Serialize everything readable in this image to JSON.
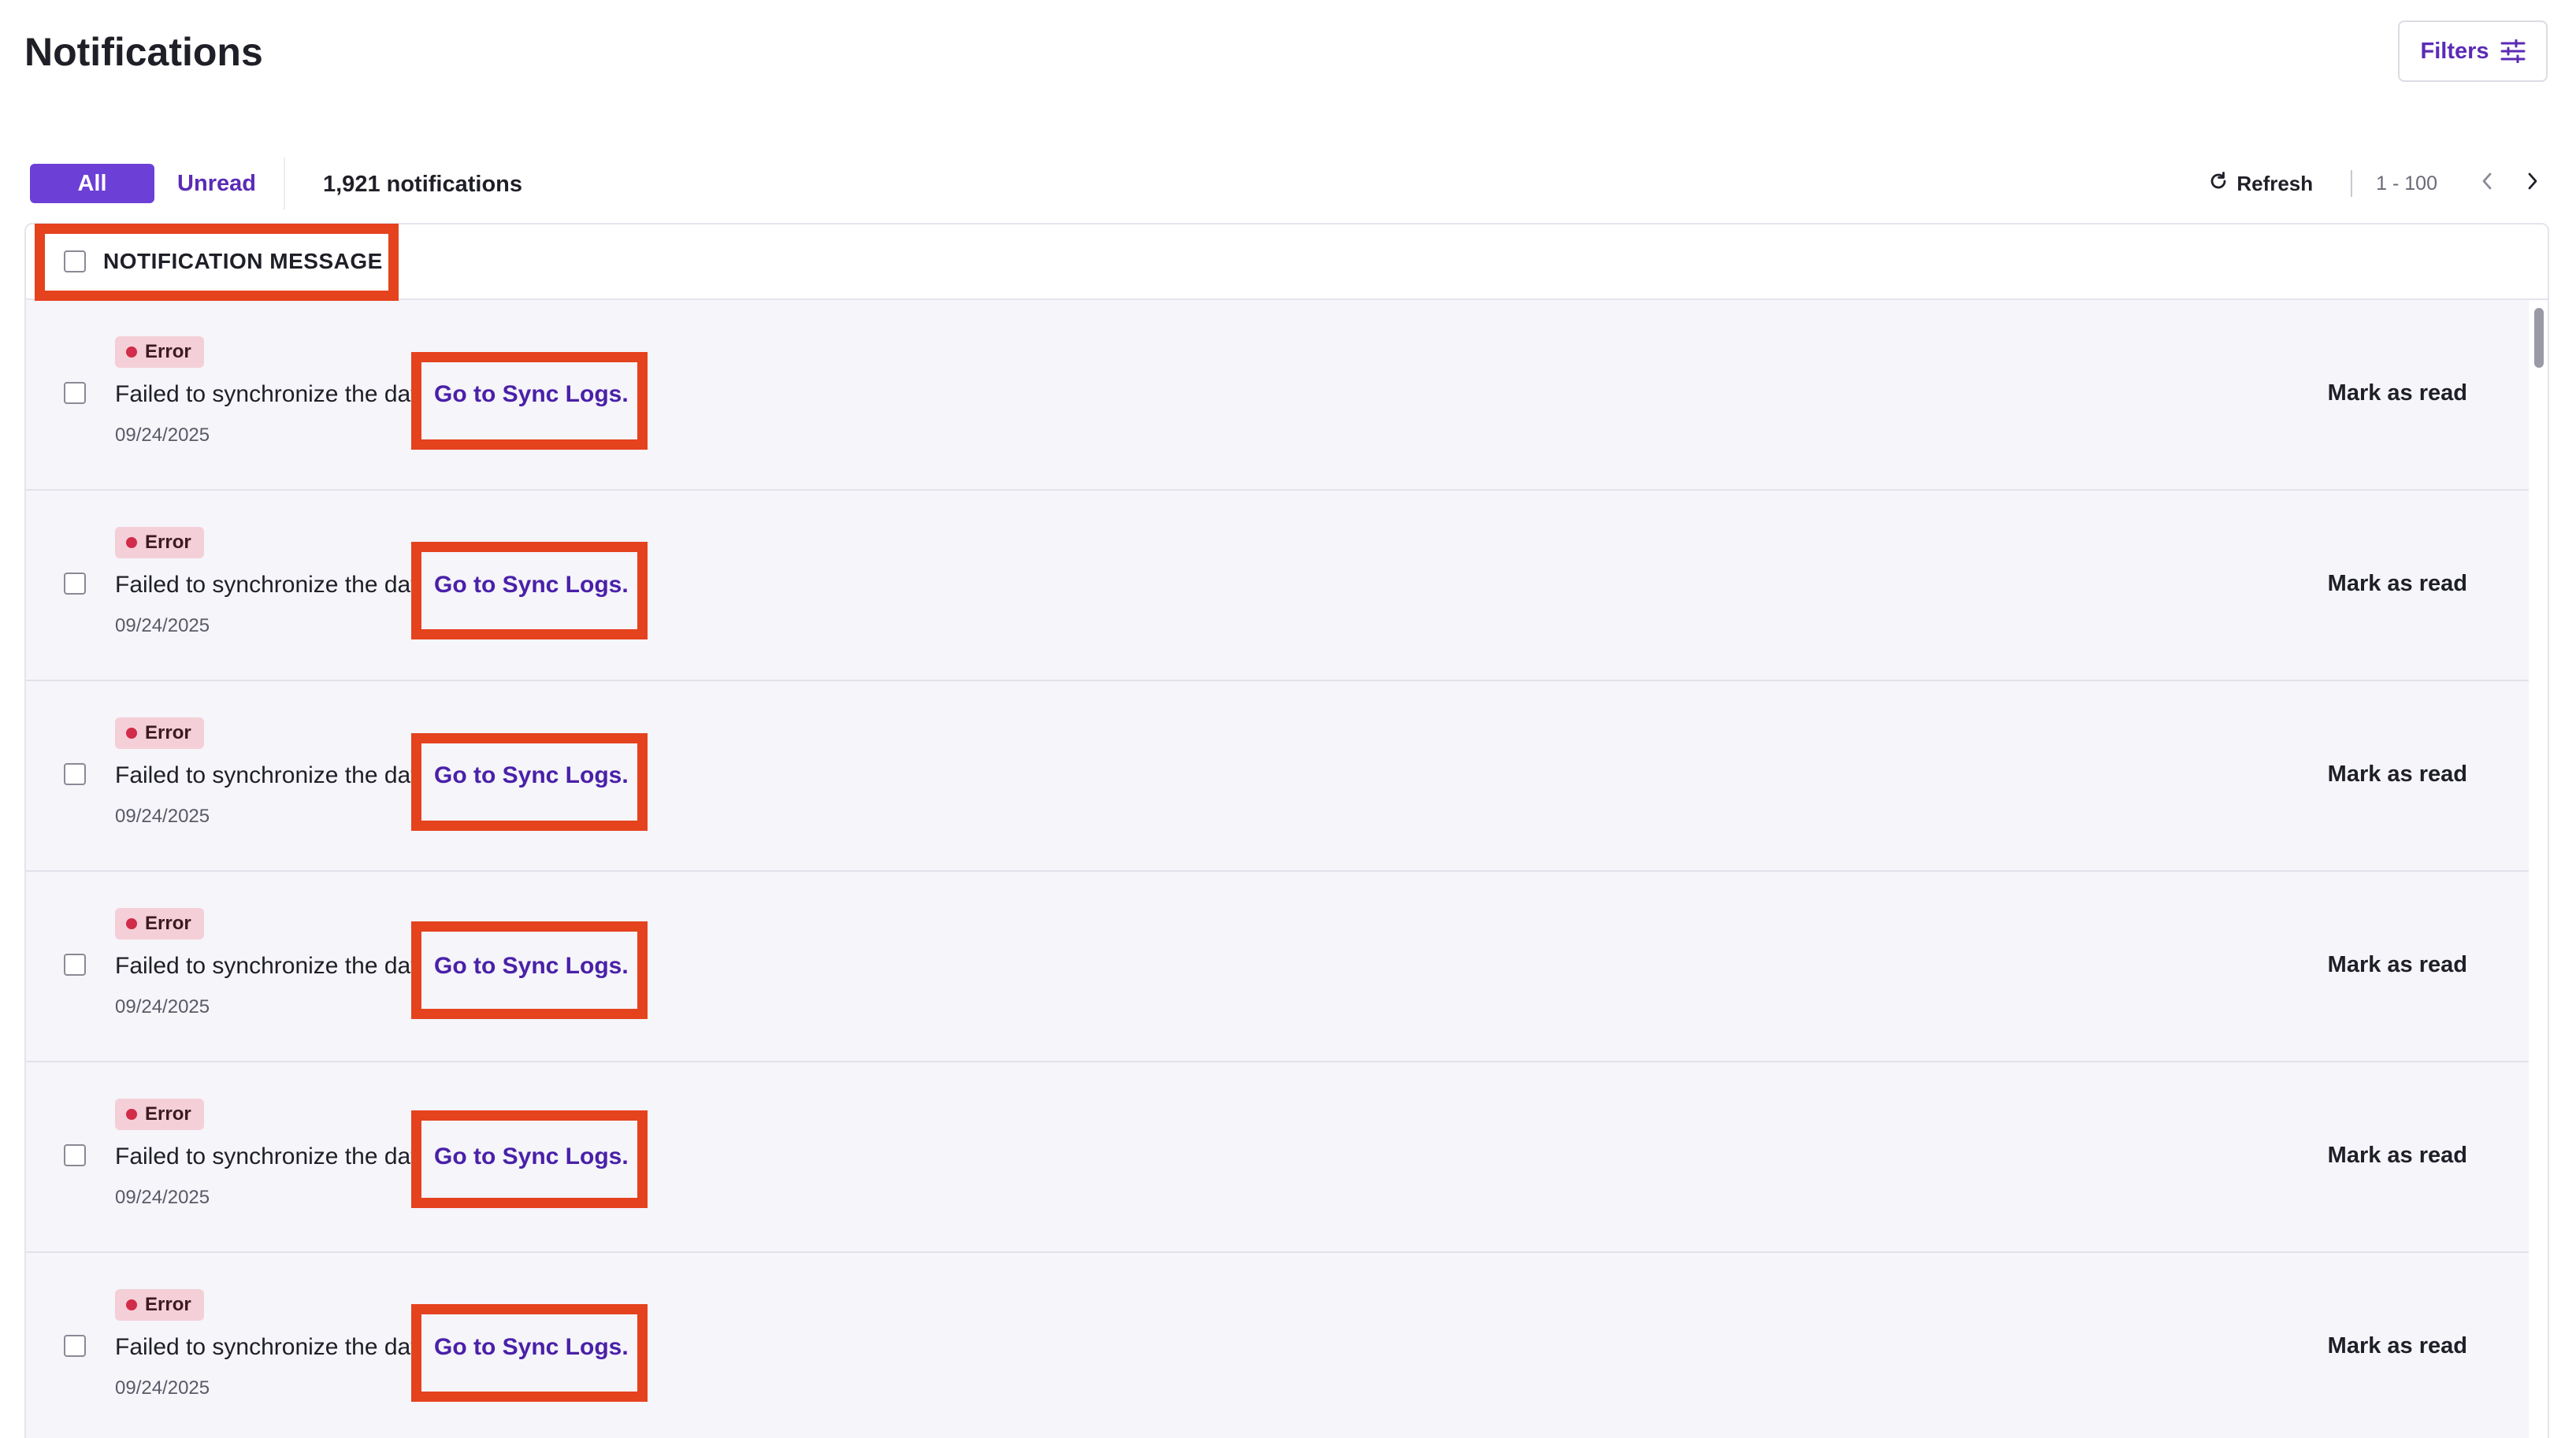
{
  "page": {
    "title": "Notifications"
  },
  "filters": {
    "label": "Filters",
    "icon": "sliders-icon"
  },
  "tabs": [
    {
      "label": "All",
      "active": true
    },
    {
      "label": "Unread",
      "active": false
    }
  ],
  "summary": {
    "count_text": "1,921 notifications"
  },
  "toolbar": {
    "refresh_label": "Refresh",
    "refresh_icon": "refresh-icon",
    "range": "1 - 100",
    "prev_icon": "chevron-left-icon",
    "next_icon": "chevron-right-icon"
  },
  "table": {
    "column_title": "NOTIFICATION MESSAGE",
    "rows": [
      {
        "badge": "Error",
        "message": "Failed to synchronize the data",
        "link": "Go to Sync Logs.",
        "date": "09/24/2025",
        "action": "Mark as read"
      },
      {
        "badge": "Error",
        "message": "Failed to synchronize the data",
        "link": "Go to Sync Logs.",
        "date": "09/24/2025",
        "action": "Mark as read"
      },
      {
        "badge": "Error",
        "message": "Failed to synchronize the data",
        "link": "Go to Sync Logs.",
        "date": "09/24/2025",
        "action": "Mark as read"
      },
      {
        "badge": "Error",
        "message": "Failed to synchronize the data",
        "link": "Go to Sync Logs.",
        "date": "09/24/2025",
        "action": "Mark as read"
      },
      {
        "badge": "Error",
        "message": "Failed to synchronize the data",
        "link": "Go to Sync Logs.",
        "date": "09/24/2025",
        "action": "Mark as read"
      },
      {
        "badge": "Error",
        "message": "Failed to synchronize the data",
        "link": "Go to Sync Logs.",
        "date": "09/24/2025",
        "action": "Mark as read"
      }
    ]
  },
  "colors": {
    "accent": "#6c3fd6",
    "link": "#4a20a8",
    "error_badge_bg": "#f5cfd7",
    "error_dot": "#d12c4a",
    "highlight": "#e5421e",
    "row_bg": "#f5f5fa"
  }
}
